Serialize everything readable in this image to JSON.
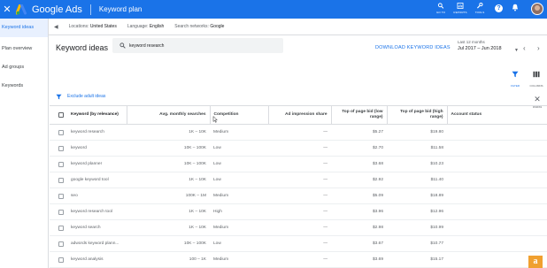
{
  "app": {
    "brand": "Google Ads",
    "page_name": "Keyword plan",
    "top_tools": [
      {
        "label": "GO TO",
        "icon": "search-icon"
      },
      {
        "label": "REPORTS",
        "icon": "reports-icon"
      },
      {
        "label": "TOOLS",
        "icon": "wrench-icon"
      }
    ]
  },
  "sidebar": {
    "items": [
      {
        "label": "Keyword ideas",
        "active": true
      },
      {
        "label": "Plan overview",
        "active": false
      },
      {
        "label": "Ad groups",
        "active": false
      },
      {
        "label": "Keywords",
        "active": false
      }
    ]
  },
  "filters": {
    "locations": "Locations:",
    "locations_value": "United States",
    "language": "Language:",
    "language_value": "English",
    "networks": "Search networks:",
    "networks_value": "Google"
  },
  "header": {
    "title": "Keyword ideas",
    "search_value": "keyword research",
    "download_label": "DOWNLOAD KEYWORD IDEAS",
    "date_caption": "Last 12 months",
    "date_value": "Jul 2017 – Jun 2018"
  },
  "tools": {
    "filter_label": "FILTER",
    "columns_label": "COLUMNS"
  },
  "exclude": {
    "label": "Exclude adult ideas",
    "dismiss_label": "DISMISS"
  },
  "table": {
    "headers": {
      "keyword": "Keyword (by relevance)",
      "avg": "Avg. monthly searches",
      "competition": "Competition",
      "impression": "Ad impression share",
      "bid_low": "Top of page bid (low range)",
      "bid_high": "Top of page bid (high range)",
      "status": "Account status"
    },
    "rows": [
      {
        "keyword": "keyword research",
        "avg": "1K – 10K",
        "competition": "Medium",
        "impression": "—",
        "bid_low": "$5.27",
        "bid_high": "$19.80"
      },
      {
        "keyword": "keyword",
        "avg": "10K – 100K",
        "competition": "Low",
        "impression": "—",
        "bid_low": "$2.70",
        "bid_high": "$11.58"
      },
      {
        "keyword": "keyword planner",
        "avg": "10K – 100K",
        "competition": "Low",
        "impression": "—",
        "bid_low": "$3.68",
        "bid_high": "$10.23"
      },
      {
        "keyword": "google keyword tool",
        "avg": "1K – 10K",
        "competition": "Low",
        "impression": "—",
        "bid_low": "$2.92",
        "bid_high": "$11.40"
      },
      {
        "keyword": "seo",
        "avg": "100K – 1M",
        "competition": "Medium",
        "impression": "—",
        "bid_low": "$5.09",
        "bid_high": "$18.89"
      },
      {
        "keyword": "keyword research tool",
        "avg": "1K – 10K",
        "competition": "High",
        "impression": "—",
        "bid_low": "$3.96",
        "bid_high": "$12.96"
      },
      {
        "keyword": "keyword search",
        "avg": "1K – 10K",
        "competition": "Medium",
        "impression": "—",
        "bid_low": "$2.98",
        "bid_high": "$10.99"
      },
      {
        "keyword": "adwords keyword plann...",
        "avg": "10K – 100K",
        "competition": "Low",
        "impression": "—",
        "bid_low": "$3.67",
        "bid_high": "$10.77"
      },
      {
        "keyword": "keyword analysis",
        "avg": "100 – 1K",
        "competition": "Medium",
        "impression": "—",
        "bid_low": "$3.69",
        "bid_high": "$15.17"
      }
    ]
  },
  "badge": {
    "letter": "a"
  },
  "colors": {
    "accent": "#1a73e8",
    "badge": "#f0a030"
  }
}
